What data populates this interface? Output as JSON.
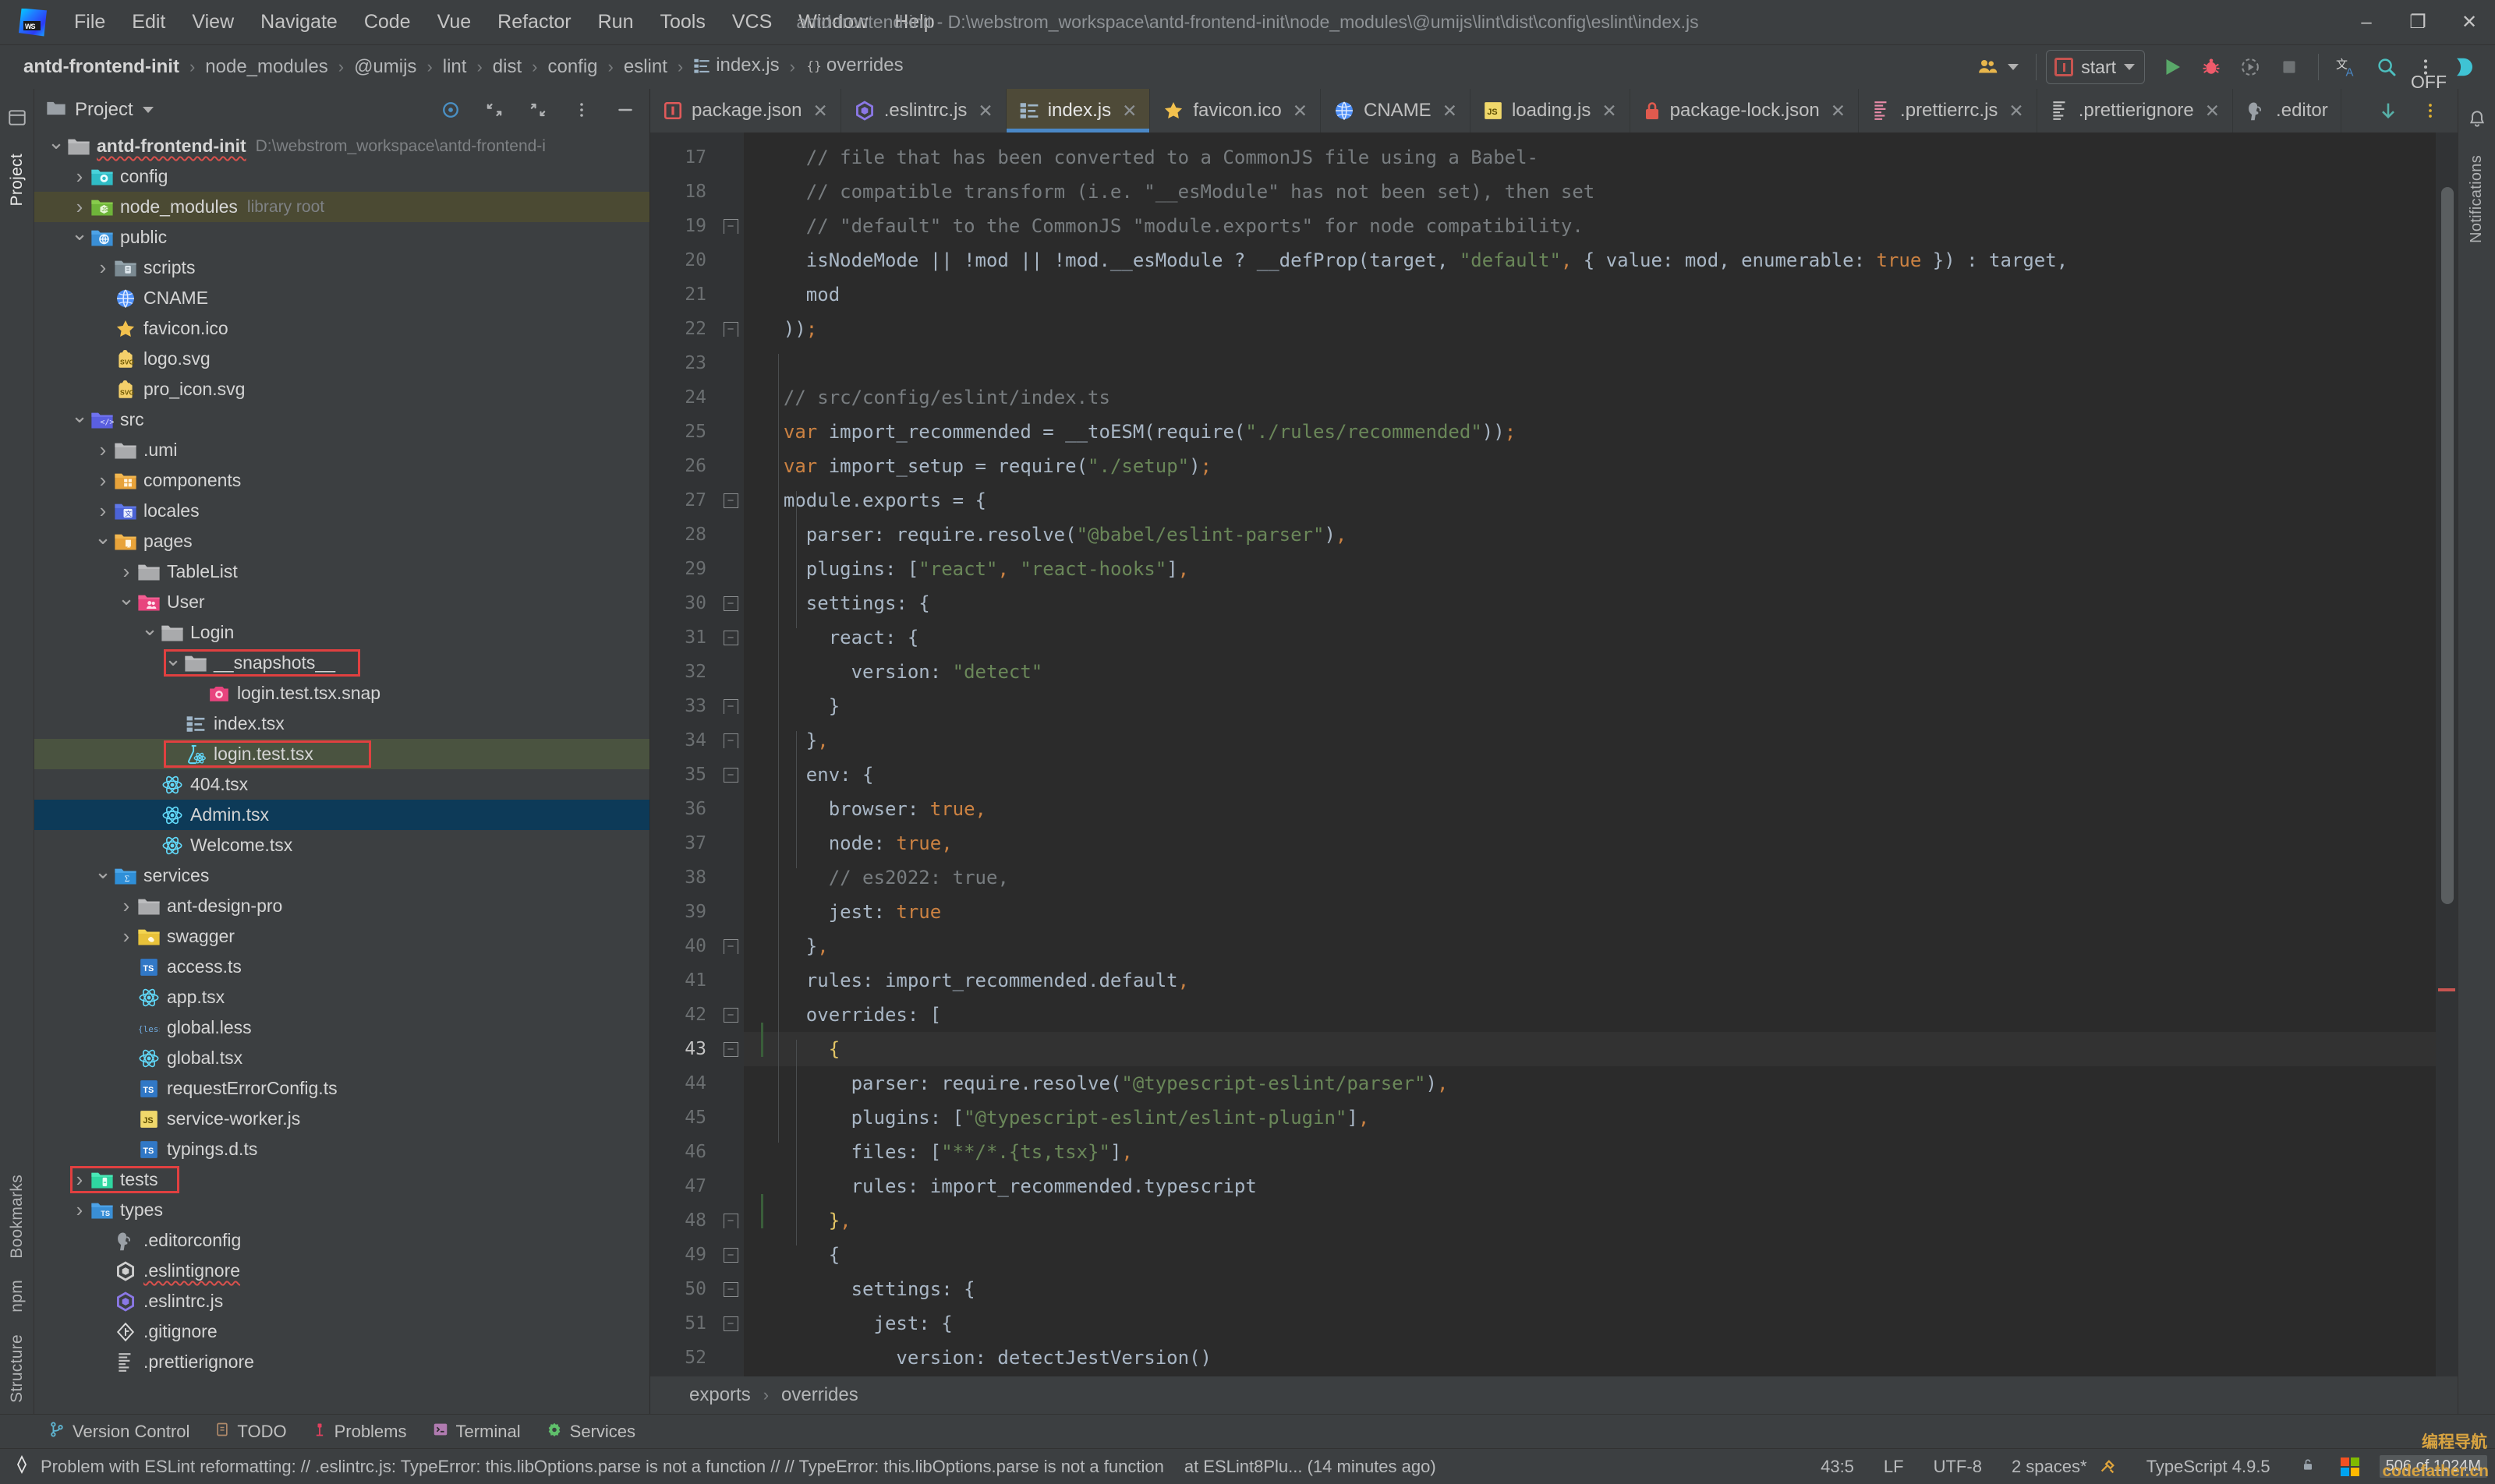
{
  "window": {
    "title": "antd-frontend-init - D:\\webstrom_workspace\\antd-frontend-init\\node_modules\\@umijs\\lint\\dist\\config\\eslint\\index.js",
    "minimize": "–",
    "maximize": "❐",
    "close": "✕"
  },
  "menu": [
    "File",
    "Edit",
    "View",
    "Navigate",
    "Code",
    "Vue",
    "Refactor",
    "Run",
    "Tools",
    "VCS",
    "Window",
    "Help"
  ],
  "breadcrumb": {
    "root": "antd-frontend-init",
    "items": [
      "node_modules",
      "@umijs",
      "lint",
      "dist",
      "config",
      "eslint",
      "index.js",
      "overrides"
    ],
    "separator": "›"
  },
  "run_config": {
    "label": "start",
    "caret": "▾"
  },
  "project_panel": {
    "title": "Project",
    "caret": "▾",
    "tree": [
      {
        "depth": 0,
        "arrow": "⌄",
        "icon": "folder-grey",
        "label": "antd-frontend-init",
        "bold": true,
        "sub": "D:\\webstrom_workspace\\antd-frontend-i",
        "squiggle": true
      },
      {
        "depth": 1,
        "arrow": "›",
        "icon": "folder-config",
        "label": "config"
      },
      {
        "depth": 1,
        "arrow": "›",
        "icon": "folder-node",
        "label": "node_modules",
        "sub": "library root",
        "rowstate": "hl-olive"
      },
      {
        "depth": 1,
        "arrow": "⌄",
        "icon": "folder-public",
        "label": "public"
      },
      {
        "depth": 2,
        "arrow": "›",
        "icon": "folder-scripts",
        "label": "scripts"
      },
      {
        "depth": 2,
        "arrow": "",
        "icon": "globe",
        "label": "CNAME"
      },
      {
        "depth": 2,
        "arrow": "",
        "icon": "star",
        "label": "favicon.ico"
      },
      {
        "depth": 2,
        "arrow": "",
        "icon": "svg",
        "label": "logo.svg"
      },
      {
        "depth": 2,
        "arrow": "",
        "icon": "svg",
        "label": "pro_icon.svg"
      },
      {
        "depth": 1,
        "arrow": "⌄",
        "icon": "folder-src",
        "label": "src"
      },
      {
        "depth": 2,
        "arrow": "›",
        "icon": "folder-grey",
        "label": ".umi"
      },
      {
        "depth": 2,
        "arrow": "›",
        "icon": "folder-components",
        "label": "components"
      },
      {
        "depth": 2,
        "arrow": "›",
        "icon": "folder-locales",
        "label": "locales"
      },
      {
        "depth": 2,
        "arrow": "⌄",
        "icon": "folder-pages",
        "label": "pages"
      },
      {
        "depth": 3,
        "arrow": "›",
        "icon": "folder-grey",
        "label": "TableList"
      },
      {
        "depth": 3,
        "arrow": "⌄",
        "icon": "folder-user",
        "label": "User"
      },
      {
        "depth": 4,
        "arrow": "⌄",
        "icon": "folder-grey",
        "label": "Login"
      },
      {
        "depth": 5,
        "arrow": "⌄",
        "icon": "folder-grey",
        "label": "__snapshots__",
        "box": true
      },
      {
        "depth": 6,
        "arrow": "",
        "icon": "snap",
        "label": "login.test.tsx.snap"
      },
      {
        "depth": 5,
        "arrow": "",
        "icon": "tsx-list",
        "label": "index.tsx"
      },
      {
        "depth": 5,
        "arrow": "",
        "icon": "flask",
        "label": "login.test.tsx",
        "box": true,
        "rowstate": "sel-green"
      },
      {
        "depth": 4,
        "arrow": "",
        "icon": "react",
        "label": "404.tsx"
      },
      {
        "depth": 4,
        "arrow": "",
        "icon": "react",
        "label": "Admin.tsx",
        "rowstate": "sel-blue"
      },
      {
        "depth": 4,
        "arrow": "",
        "icon": "react",
        "label": "Welcome.tsx"
      },
      {
        "depth": 2,
        "arrow": "⌄",
        "icon": "folder-services",
        "label": "services"
      },
      {
        "depth": 3,
        "arrow": "›",
        "icon": "folder-grey",
        "label": "ant-design-pro"
      },
      {
        "depth": 3,
        "arrow": "›",
        "icon": "folder-swagger",
        "label": "swagger"
      },
      {
        "depth": 3,
        "arrow": "",
        "icon": "ts",
        "label": "access.ts"
      },
      {
        "depth": 3,
        "arrow": "",
        "icon": "react",
        "label": "app.tsx"
      },
      {
        "depth": 3,
        "arrow": "",
        "icon": "less",
        "label": "global.less"
      },
      {
        "depth": 3,
        "arrow": "",
        "icon": "react",
        "label": "global.tsx"
      },
      {
        "depth": 3,
        "arrow": "",
        "icon": "ts",
        "label": "requestErrorConfig.ts"
      },
      {
        "depth": 3,
        "arrow": "",
        "icon": "js",
        "label": "service-worker.js"
      },
      {
        "depth": 3,
        "arrow": "",
        "icon": "ts",
        "label": "typings.d.ts"
      },
      {
        "depth": 1,
        "arrow": "›",
        "icon": "folder-tests",
        "label": "tests",
        "box": true
      },
      {
        "depth": 1,
        "arrow": "›",
        "icon": "folder-types",
        "label": "types"
      },
      {
        "depth": 2,
        "arrow": "",
        "icon": "editorconfig",
        "label": ".editorconfig"
      },
      {
        "depth": 2,
        "arrow": "",
        "icon": "eslint-grey",
        "label": ".eslintignore",
        "squiggle": true
      },
      {
        "depth": 2,
        "arrow": "",
        "icon": "eslint",
        "label": ".eslintrc.js"
      },
      {
        "depth": 2,
        "arrow": "",
        "icon": "git",
        "label": ".gitignore"
      },
      {
        "depth": 2,
        "arrow": "",
        "icon": "prettier-grey",
        "label": ".prettierignore"
      }
    ]
  },
  "left_rail": [
    "Project",
    "Bookmarks",
    "npm",
    "Structure"
  ],
  "right_rail": [
    "Notifications"
  ],
  "editor_tabs": [
    {
      "label": "package.json",
      "icon": "json-pink",
      "active": false
    },
    {
      "label": ".eslintrc.js",
      "icon": "eslint",
      "active": false
    },
    {
      "label": "index.js",
      "icon": "tsx-list",
      "active": true
    },
    {
      "label": "favicon.ico",
      "icon": "star",
      "active": false
    },
    {
      "label": "CNAME",
      "icon": "globe",
      "active": false
    },
    {
      "label": "loading.js",
      "icon": "js",
      "active": false
    },
    {
      "label": "package-lock.json",
      "icon": "lock",
      "active": false
    },
    {
      "label": ".prettierrc.js",
      "icon": "prettier-pink",
      "active": false
    },
    {
      "label": ".prettierignore",
      "icon": "prettier-grey",
      "active": false
    },
    {
      "label": ".editor",
      "icon": "editorconfig",
      "active": false
    }
  ],
  "editor_tab_close": "✕",
  "overlay_label": "OFF",
  "code": {
    "first_line": 17,
    "current_line": 43,
    "lines": [
      {
        "n": 17,
        "fold": "",
        "html": "    <span class=\"tok-cmt\">// file that has been converted to a CommonJS file using a Babel-</span>"
      },
      {
        "n": 18,
        "fold": "",
        "html": "    <span class=\"tok-cmt\">// compatible transform (i.e. \"__esModule\" has not been set), then set</span>"
      },
      {
        "n": 19,
        "fold": "end",
        "html": "    <span class=\"tok-cmt\">// \"default\" to the CommonJS \"module.exports\" for node compatibility.</span>"
      },
      {
        "n": 20,
        "fold": "",
        "html": "    isNodeMode || !mod || !mod.__esModule ? __defProp(target, <span class=\"tok-str\">\"default\"</span><span class=\"tok-punc\">,</span> { value: mod, enumerable: <span class=\"tok-kw\">true</span> }) : target,"
      },
      {
        "n": 21,
        "fold": "",
        "html": "    mod"
      },
      {
        "n": 22,
        "fold": "end",
        "html": "  ))<span class=\"tok-punc\">;</span>"
      },
      {
        "n": 23,
        "fold": "",
        "html": ""
      },
      {
        "n": 24,
        "fold": "",
        "html": "  <span class=\"tok-cmt\">// src/config/eslint/index.ts</span>"
      },
      {
        "n": 25,
        "fold": "",
        "html": "  <span class=\"tok-kw\">var</span> import_recommended = __toESM(require(<span class=\"tok-str\">\"./rules/recommended\"</span>))<span class=\"tok-punc\">;</span>"
      },
      {
        "n": 26,
        "fold": "",
        "html": "  <span class=\"tok-kw\">var</span> import_setup = require(<span class=\"tok-str\">\"./setup\"</span>)<span class=\"tok-punc\">;</span>"
      },
      {
        "n": 27,
        "fold": "start",
        "html": "  module.exports = {"
      },
      {
        "n": 28,
        "fold": "",
        "html": "    parser: require.resolve(<span class=\"tok-str\">\"@babel/eslint-parser\"</span>)<span class=\"tok-punc\">,</span>"
      },
      {
        "n": 29,
        "fold": "",
        "html": "    plugins: [<span class=\"tok-str\">\"react\"</span><span class=\"tok-punc\">,</span> <span class=\"tok-str\">\"react-hooks\"</span>]<span class=\"tok-punc\">,</span>"
      },
      {
        "n": 30,
        "fold": "start",
        "html": "    settings: {"
      },
      {
        "n": 31,
        "fold": "start",
        "html": "      react: {"
      },
      {
        "n": 32,
        "fold": "",
        "html": "        version: <span class=\"tok-str\">\"detect\"</span>"
      },
      {
        "n": 33,
        "fold": "end",
        "html": "      }"
      },
      {
        "n": 34,
        "fold": "end",
        "html": "    }<span class=\"tok-punc\">,</span>"
      },
      {
        "n": 35,
        "fold": "start",
        "html": "    env: {"
      },
      {
        "n": 36,
        "fold": "",
        "html": "      browser: <span class=\"tok-kw\">true</span><span class=\"tok-punc\">,</span>"
      },
      {
        "n": 37,
        "fold": "",
        "html": "      node: <span class=\"tok-kw\">true</span><span class=\"tok-punc\">,</span>"
      },
      {
        "n": 38,
        "fold": "",
        "html": "      <span class=\"tok-cmt\">// es2022: true,</span>"
      },
      {
        "n": 39,
        "fold": "",
        "html": "      jest: <span class=\"tok-kw\">true</span>"
      },
      {
        "n": 40,
        "fold": "end",
        "html": "    }<span class=\"tok-punc\">,</span>"
      },
      {
        "n": 41,
        "fold": "",
        "html": "    rules: import_recommended.default<span class=\"tok-punc\">,</span>"
      },
      {
        "n": 42,
        "fold": "start",
        "html": "    overrides: ["
      },
      {
        "n": 43,
        "fold": "start",
        "html": "      <span class=\"tok-yel\">{</span>",
        "current": true
      },
      {
        "n": 44,
        "fold": "",
        "html": "        parser: require.resolve(<span class=\"tok-str\">\"@typescript-eslint/parser\"</span>)<span class=\"tok-punc\">,</span>"
      },
      {
        "n": 45,
        "fold": "",
        "html": "        plugins: [<span class=\"tok-str\">\"@typescript-eslint/eslint-plugin\"</span>]<span class=\"tok-punc\">,</span>"
      },
      {
        "n": 46,
        "fold": "",
        "html": "        files: [<span class=\"tok-str\">\"**/*.{ts,tsx}\"</span>]<span class=\"tok-punc\">,</span>"
      },
      {
        "n": 47,
        "fold": "",
        "html": "        rules: import_recommended.typescript"
      },
      {
        "n": 48,
        "fold": "end",
        "html": "      <span class=\"tok-yel\">}</span><span class=\"tok-punc\">,</span>"
      },
      {
        "n": 49,
        "fold": "start",
        "html": "      {"
      },
      {
        "n": 50,
        "fold": "start",
        "html": "        settings: {"
      },
      {
        "n": 51,
        "fold": "start",
        "html": "          jest: {"
      },
      {
        "n": 52,
        "fold": "",
        "html": "            version: detectJestVersion()"
      }
    ]
  },
  "editor_breadcrumbs": [
    "exports",
    "overrides"
  ],
  "tool_windows": [
    {
      "label": "Version Control",
      "icon": "branch-icon"
    },
    {
      "label": "TODO",
      "icon": "todo-icon"
    },
    {
      "label": "Problems",
      "icon": "problems-icon"
    },
    {
      "label": "Terminal",
      "icon": "terminal-icon"
    },
    {
      "label": "Services",
      "icon": "services-icon"
    }
  ],
  "status_bar": {
    "message": "Problem with ESLint reformatting: // .eslintrc.js: TypeError: this.libOptions.parse is not a function // // TypeError: this.libOptions.parse is not a function",
    "message_suffix": "at ESLint8Plu... (14 minutes ago)",
    "caret_position": "43:5",
    "line_separator": "LF",
    "encoding": "UTF-8",
    "indent": "2 spaces*",
    "language_version": "TypeScript 4.9.5",
    "memory": "506 of 1024M",
    "watermark": "codefather.cn",
    "watermark2": "编程导航"
  }
}
